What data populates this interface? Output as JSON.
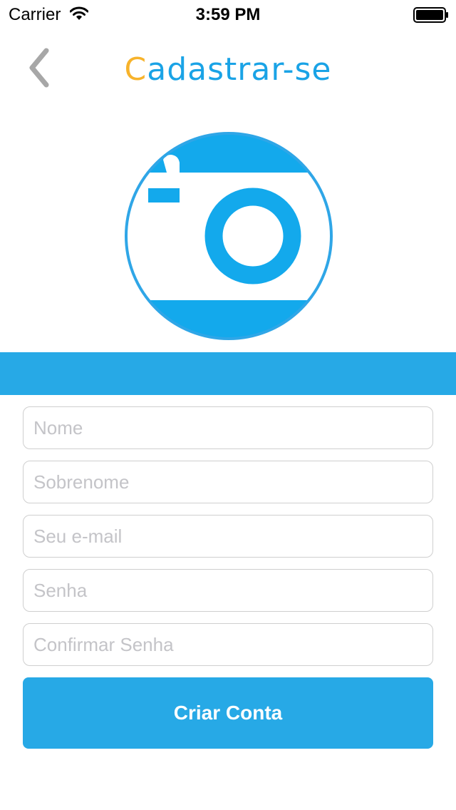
{
  "status_bar": {
    "carrier": "Carrier",
    "time": "3:59 PM",
    "icons": [
      "wifi-icon",
      "battery-icon"
    ]
  },
  "header": {
    "back_icon": "chevron-left-icon",
    "title_first_letter": "C",
    "title_rest": "adastrar-se"
  },
  "photo": {
    "icon": "camera-icon"
  },
  "form": {
    "fields": [
      {
        "placeholder": "Nome",
        "value": ""
      },
      {
        "placeholder": "Sobrenome",
        "value": ""
      },
      {
        "placeholder": "Seu e-mail",
        "value": ""
      },
      {
        "placeholder": "Senha",
        "value": ""
      },
      {
        "placeholder": "Confirmar Senha",
        "value": ""
      }
    ],
    "submit_label": "Criar Conta"
  },
  "colors": {
    "accent": "#27a9e6",
    "title_blue": "#1aa3e6",
    "title_first_letter": "#f7b32b",
    "back_chevron": "#a7a7a7",
    "placeholder": "#c4c4c8"
  }
}
